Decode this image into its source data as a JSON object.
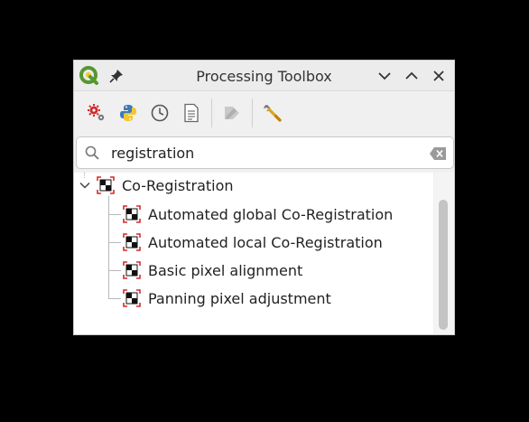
{
  "window": {
    "title": "Processing Toolbox",
    "logo_icon": "qgis-logo-icon",
    "buttons": [
      "pin-icon",
      "chevron-down-icon",
      "chevron-up-icon",
      "close-icon"
    ]
  },
  "toolbar": {
    "tools": [
      {
        "name": "models-icon"
      },
      {
        "name": "python-icon"
      },
      {
        "name": "history-icon"
      },
      {
        "name": "results-viewer-icon"
      },
      {
        "name": "edit-features-icon",
        "disabled": true
      },
      {
        "name": "options-wrench-icon"
      }
    ]
  },
  "search": {
    "value": "registration",
    "placeholder": ""
  },
  "tree": {
    "group": {
      "label": "Co-Registration",
      "expanded": true
    },
    "items": [
      {
        "label": "Automated global Co-Registration"
      },
      {
        "label": "Automated local Co-Registration"
      },
      {
        "label": "Basic pixel alignment"
      },
      {
        "label": "Panning pixel adjustment"
      }
    ]
  },
  "colors": {
    "qgis_green": "#589632",
    "qgis_yellow": "#f0c929",
    "algo_red": "#d42a2a"
  }
}
